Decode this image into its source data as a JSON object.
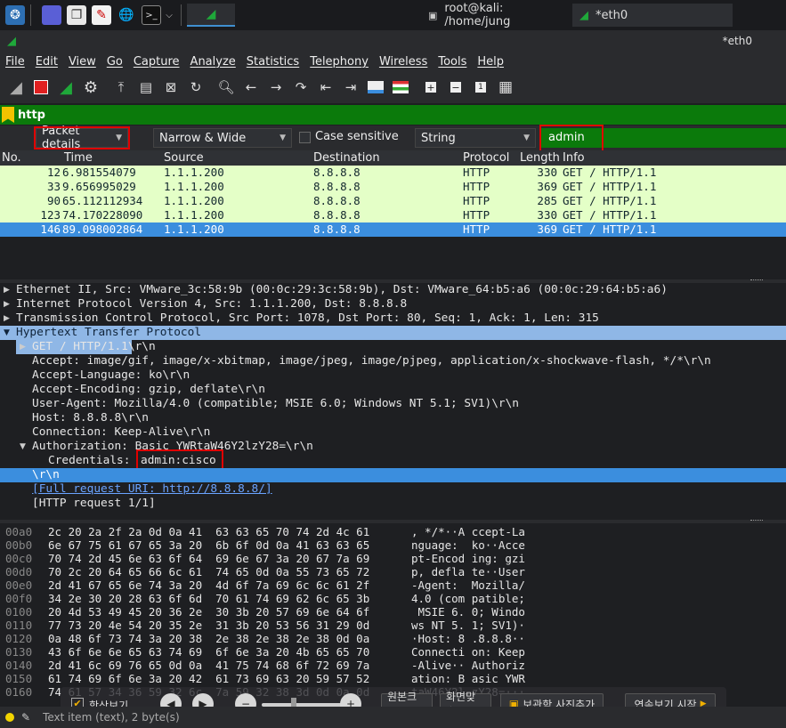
{
  "taskbar": {
    "tasks": [
      {
        "label": "root@kali: /home/jung"
      },
      {
        "label": "*eth0"
      }
    ]
  },
  "window": {
    "title": "*eth0"
  },
  "menu": [
    "File",
    "Edit",
    "View",
    "Go",
    "Capture",
    "Analyze",
    "Statistics",
    "Telephony",
    "Wireless",
    "Tools",
    "Help"
  ],
  "display_filter": "http",
  "find": {
    "search_in": "Packet details",
    "char_width": "Narrow & Wide",
    "case_sensitive_label": "Case sensitive",
    "search_type": "String",
    "search_value": "admin"
  },
  "packet_list": {
    "columns": [
      "No.",
      "Time",
      "Source",
      "Destination",
      "Protocol",
      "Length",
      "Info"
    ],
    "rows": [
      {
        "no": "12",
        "time": "6.981554079",
        "src": "1.1.1.200",
        "dst": "8.8.8.8",
        "proto": "HTTP",
        "len": "330",
        "info": "GET / HTTP/1.1"
      },
      {
        "no": "33",
        "time": "9.656995029",
        "src": "1.1.1.200",
        "dst": "8.8.8.8",
        "proto": "HTTP",
        "len": "369",
        "info": "GET / HTTP/1.1"
      },
      {
        "no": "90",
        "time": "65.112112934",
        "src": "1.1.1.200",
        "dst": "8.8.8.8",
        "proto": "HTTP",
        "len": "285",
        "info": "GET / HTTP/1.1"
      },
      {
        "no": "123",
        "time": "74.170228090",
        "src": "1.1.1.200",
        "dst": "8.8.8.8",
        "proto": "HTTP",
        "len": "330",
        "info": "GET / HTTP/1.1"
      },
      {
        "no": "146",
        "time": "89.098002864",
        "src": "1.1.1.200",
        "dst": "8.8.8.8",
        "proto": "HTTP",
        "len": "369",
        "info": "GET / HTTP/1.1"
      }
    ]
  },
  "details": [
    "Ethernet II, Src: VMware_3c:58:9b (00:0c:29:3c:58:9b), Dst: VMware_64:b5:a6 (00:0c:29:64:b5:a6)",
    "Internet Protocol Version 4, Src: 1.1.1.200, Dst: 8.8.8.8",
    "Transmission Control Protocol, Src Port: 1078, Dst Port: 80, Seq: 1, Ack: 1, Len: 315",
    "Hypertext Transfer Protocol",
    "GET / HTTP/1.1\\r\\n",
    "Accept: image/gif, image/x-xbitmap, image/jpeg, image/pjpeg, application/x-shockwave-flash, */*\\r\\n",
    "Accept-Language: ko\\r\\n",
    "Accept-Encoding: gzip, deflate\\r\\n",
    "User-Agent: Mozilla/4.0 (compatible; MSIE 6.0; Windows NT 5.1; SV1)\\r\\n",
    "Host: 8.8.8.8\\r\\n",
    "Connection: Keep-Alive\\r\\n",
    "Authorization: Basic YWRtaW46Y2lzY28=\\r\\n",
    "Credentials: ",
    "admin:cisco",
    "\\r\\n",
    "[Full request URI: http://8.8.8.8/]",
    "[HTTP request 1/1]"
  ],
  "bytes": [
    {
      "off": "00a0",
      "hex": "2c 20 2a 2f 2a 0d 0a 41  63 63 65 70 74 2d 4c 61",
      "ascii": ", */*··A ccept-La"
    },
    {
      "off": "00b0",
      "hex": "6e 67 75 61 67 65 3a 20  6b 6f 0d 0a 41 63 63 65",
      "ascii": "nguage:  ko··Acce"
    },
    {
      "off": "00c0",
      "hex": "70 74 2d 45 6e 63 6f 64  69 6e 67 3a 20 67 7a 69",
      "ascii": "pt-Encod ing: gzi"
    },
    {
      "off": "00d0",
      "hex": "70 2c 20 64 65 66 6c 61  74 65 0d 0a 55 73 65 72",
      "ascii": "p, defla te··User"
    },
    {
      "off": "00e0",
      "hex": "2d 41 67 65 6e 74 3a 20  4d 6f 7a 69 6c 6c 61 2f",
      "ascii": "-Agent:  Mozilla/"
    },
    {
      "off": "00f0",
      "hex": "34 2e 30 20 28 63 6f 6d  70 61 74 69 62 6c 65 3b",
      "ascii": "4.0 (com patible;"
    },
    {
      "off": "0100",
      "hex": "20 4d 53 49 45 20 36 2e  30 3b 20 57 69 6e 64 6f",
      "ascii": " MSIE 6. 0; Windo"
    },
    {
      "off": "0110",
      "hex": "77 73 20 4e 54 20 35 2e  31 3b 20 53 56 31 29 0d",
      "ascii": "ws NT 5. 1; SV1)·"
    },
    {
      "off": "0120",
      "hex": "0a 48 6f 73 74 3a 20 38  2e 38 2e 38 2e 38 0d 0a",
      "ascii": "·Host: 8 .8.8.8··"
    },
    {
      "off": "0130",
      "hex": "43 6f 6e 6e 65 63 74 69  6f 6e 3a 20 4b 65 65 70",
      "ascii": "Connecti on: Keep"
    },
    {
      "off": "0140",
      "hex": "2d 41 6c 69 76 65 0d 0a  41 75 74 68 6f 72 69 7a",
      "ascii": "-Alive·· Authoriz"
    },
    {
      "off": "0150",
      "hex": "61 74 69 6f 6e 3a 20 42  61 73 69 63 20 59 57 52",
      "ascii": "ation: B asic YWR"
    },
    {
      "off": "0160",
      "hex": "74 61 57 34 36 59 32 6c  7a 59 32 38 3d 0d 0a 0d",
      "ascii": "taW46Y2l zY28=···"
    }
  ],
  "viewer": {
    "always_view": "항상보기",
    "original_size": "원본크기",
    "fit_screen": "화면맞춤",
    "add_photo": "보관함 사진추가",
    "slideshow": "연속보기 시작"
  },
  "status": {
    "text": "Text item (text), 2 byte(s)"
  },
  "colors": {
    "accent": "#3b8ede",
    "filter_ok": "#0b7a0b",
    "row_bg": "#e4ffc7",
    "highlight_box": "#e00000"
  }
}
